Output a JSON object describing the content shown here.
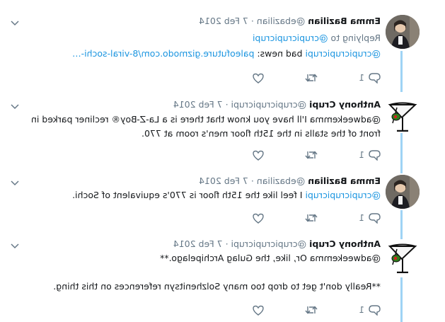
{
  "tweets": [
    {
      "name": "Emma Bazilian",
      "handle": "@ebazilian",
      "time": "7 Feb 2014",
      "reply_prefix": "Replying to",
      "reply_handle": "@crupicrupicrupi",
      "mention": "@crupicrupicrupi",
      "text": " bad news: ",
      "link": "paleofuture.gizmodo.com/8-viral-sochi-…",
      "reply_count": "1"
    },
    {
      "name": "Anthony Crupi",
      "handle": "@crupicrupicrupi",
      "time": "7 Feb 2014",
      "text": "@adweekemma I'll have you know that there is a La-Z-Boy® recliner parked in front of the stalls in the 15th floor men's room at 770.",
      "reply_count": "1"
    },
    {
      "name": "Emma Bazilian",
      "handle": "@ebazilian",
      "time": "7 Feb 2014",
      "mention": "@crupicrupicrupi",
      "text": " I feel like the 15th floor is 770's equivalent of Sochi.",
      "reply_count": "1"
    },
    {
      "name": "Anthony Crupi",
      "handle": "@crupicrupicrupi",
      "time": "7 Feb 2014",
      "text": "@adweekemma Or, like, the Gulag Archipelago.**",
      "text2": "**Really don't get to drop too many Solzhenitsyn references on this thing.",
      "reply_count": "1"
    }
  ],
  "separator": "·",
  "colors": {
    "link": "#1b95e0",
    "muted": "#657786",
    "thread": "#9fd3f5"
  },
  "icons": [
    "reply-icon",
    "retweet-icon",
    "like-icon",
    "chevron-down-icon"
  ]
}
